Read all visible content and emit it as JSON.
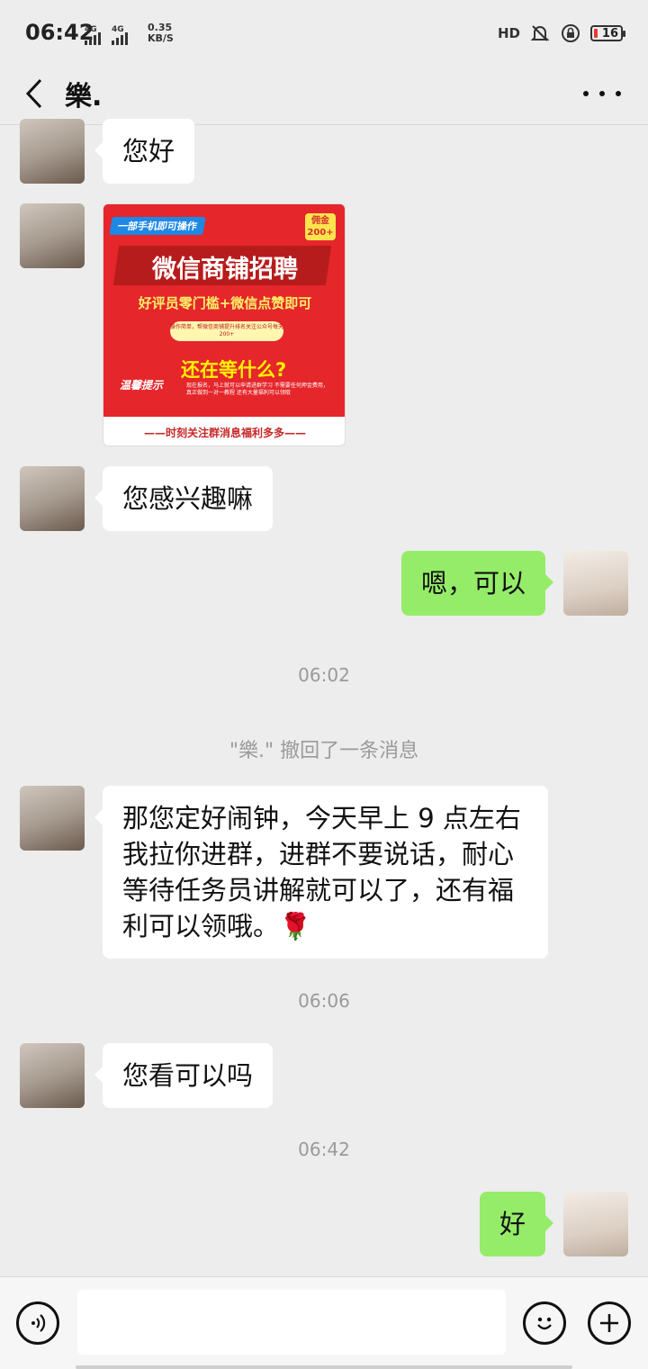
{
  "status_bar": {
    "time": "06:42",
    "network_1": "4G",
    "network_2": "4G",
    "speed_value": "0.35",
    "speed_unit": "KB/S",
    "hd_label": "HD",
    "battery": "16"
  },
  "header": {
    "title": "樂.",
    "back_icon": "chevron-left-icon",
    "more_icon": "more-dots-icon"
  },
  "messages": [
    {
      "sender": "contact",
      "text": "您好"
    },
    {
      "sender": "contact",
      "type": "image",
      "poster": {
        "top_tag": "一部手机即可操作",
        "badge": "佣金200+",
        "headline": "微信商铺招聘",
        "subline": "好评员零门槛+微信点赞即可",
        "pill_text": "操作简单，帮微信商铺提升排名关注公众号每天200+",
        "ask": "还在等什么?",
        "logo": "温馨提示",
        "small_text": "现在报名，马上就可以申请进群学习 不需要任何押金费用，真正做到一对一教程 还有大量福利可以领取",
        "footer": "——时刻关注群消息福利多多——"
      }
    },
    {
      "sender": "contact",
      "text": "您感兴趣嘛"
    },
    {
      "sender": "me",
      "text": "嗯，可以"
    },
    {
      "sender": "system",
      "time": "06:02"
    },
    {
      "sender": "system",
      "notice": "\"樂.\" 撤回了一条消息"
    },
    {
      "sender": "contact",
      "text_lines": [
        "那您定好闹钟，今天早上 9 点左右",
        "我拉你进群，进群不要说话，耐心",
        "等待任务员讲解就可以了，还有福",
        "利可以领哦。🌹"
      ]
    },
    {
      "sender": "system",
      "time": "06:06"
    },
    {
      "sender": "contact",
      "text": "您看可以吗"
    },
    {
      "sender": "system",
      "time": "06:42"
    },
    {
      "sender": "me",
      "text": "好"
    }
  ],
  "input_bar": {
    "voice_icon": "voice-icon",
    "input_value": "",
    "emoji_icon": "emoji-icon",
    "plus_icon": "plus-icon"
  },
  "colors": {
    "background": "#ededed",
    "outgoing_bubble": "#95ec69",
    "incoming_bubble": "#ffffff",
    "battery_low": "#e53935"
  }
}
